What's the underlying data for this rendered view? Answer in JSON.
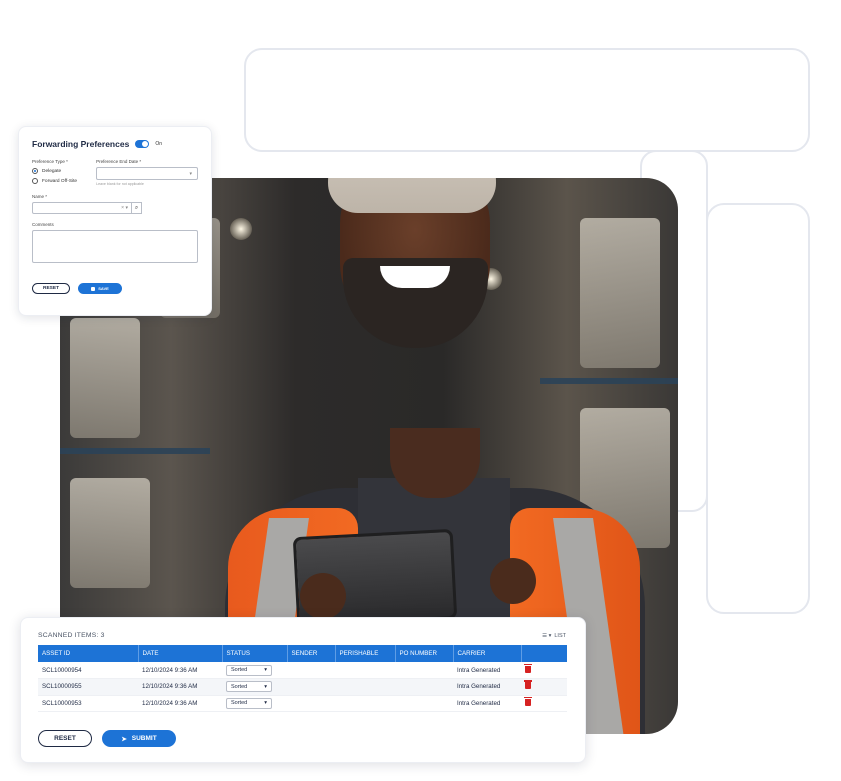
{
  "forwarding": {
    "title": "Forwarding Preferences",
    "toggle_label": "On",
    "preference_type_label": "Preference Type *",
    "options": [
      "Delegate",
      "Forward Off-Site"
    ],
    "end_date_label": "Preference End Date *",
    "end_date_hint": "Leave blank for not applicable",
    "name_label": "Name *",
    "comments_label": "Comments",
    "reset_label": "RESET",
    "save_label": "SAVE"
  },
  "scanned": {
    "title": "SCANNED ITEMS: 3",
    "view_label": "LIST",
    "columns": [
      "ASSET ID",
      "DATE",
      "STATUS",
      "SENDER",
      "PERISHABLE",
      "PO NUMBER",
      "CARRIER",
      ""
    ],
    "rows": [
      {
        "asset_id": "SCL10000954",
        "date": "12/10/2024 9:36 AM",
        "status": "Sorted",
        "sender": "",
        "perishable": "",
        "po_number": "",
        "carrier": "Intra Generated"
      },
      {
        "asset_id": "SCL10000955",
        "date": "12/10/2024 9:36 AM",
        "status": "Sorted",
        "sender": "",
        "perishable": "",
        "po_number": "",
        "carrier": "Intra Generated"
      },
      {
        "asset_id": "SCL10000953",
        "date": "12/10/2024 9:36 AM",
        "status": "Sorted",
        "sender": "",
        "perishable": "",
        "po_number": "",
        "carrier": "Intra Generated"
      }
    ],
    "reset_label": "RESET",
    "submit_label": "SUBMIT"
  },
  "colors": {
    "accent": "#1d73d6",
    "delete": "#d62222",
    "vest": "#f26a22"
  }
}
